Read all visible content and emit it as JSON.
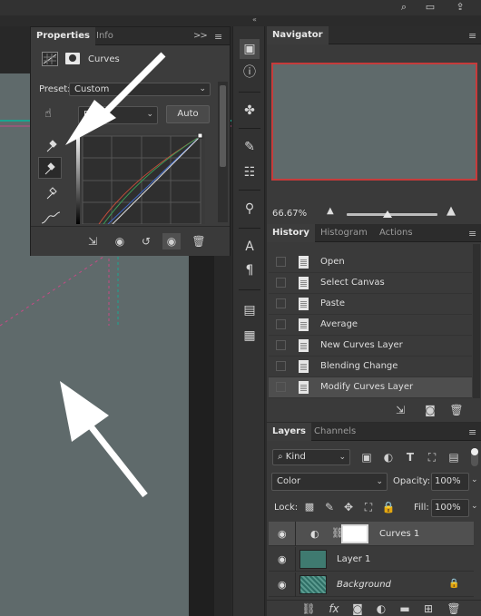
{
  "topbar": {
    "icons": [
      "search-icon",
      "workspace-icon",
      "share-icon"
    ],
    "collapse_glyph": "«"
  },
  "properties": {
    "tabs": [
      "Properties",
      "Info"
    ],
    "expand_glyph": ">>",
    "adjustment_title": "Curves",
    "preset_label": "Preset:",
    "preset_value": "Custom",
    "channel_value": "R",
    "auto_label": "Auto"
  },
  "navigator": {
    "title": "Navigator",
    "zoom": "66.67%",
    "zoom_level": 0.45
  },
  "history": {
    "tabs": [
      "History",
      "Histogram",
      "Actions"
    ],
    "items": [
      "Open",
      "Select Canvas",
      "Paste",
      "Average",
      "New Curves Layer",
      "Blending Change",
      "Modify Curves Layer"
    ],
    "selected_index": 6
  },
  "layers": {
    "tabs": [
      "Layers",
      "Channels"
    ],
    "filter_kind": "Kind",
    "blend_mode": "Color",
    "opacity_label": "Opacity:",
    "opacity_value": "100%",
    "lock_label": "Lock:",
    "fill_label": "Fill:",
    "fill_value": "100%",
    "items": [
      {
        "name": "Curves 1",
        "selected": true
      },
      {
        "name": "Layer 1",
        "selected": false
      },
      {
        "name": "Background",
        "selected": false
      }
    ]
  },
  "colors": {
    "canvas": "#5f6a6b",
    "layer1_thumb": "#3f7a70",
    "navigator_frame": "#c63b3b",
    "panel": "#3a3a3a"
  }
}
